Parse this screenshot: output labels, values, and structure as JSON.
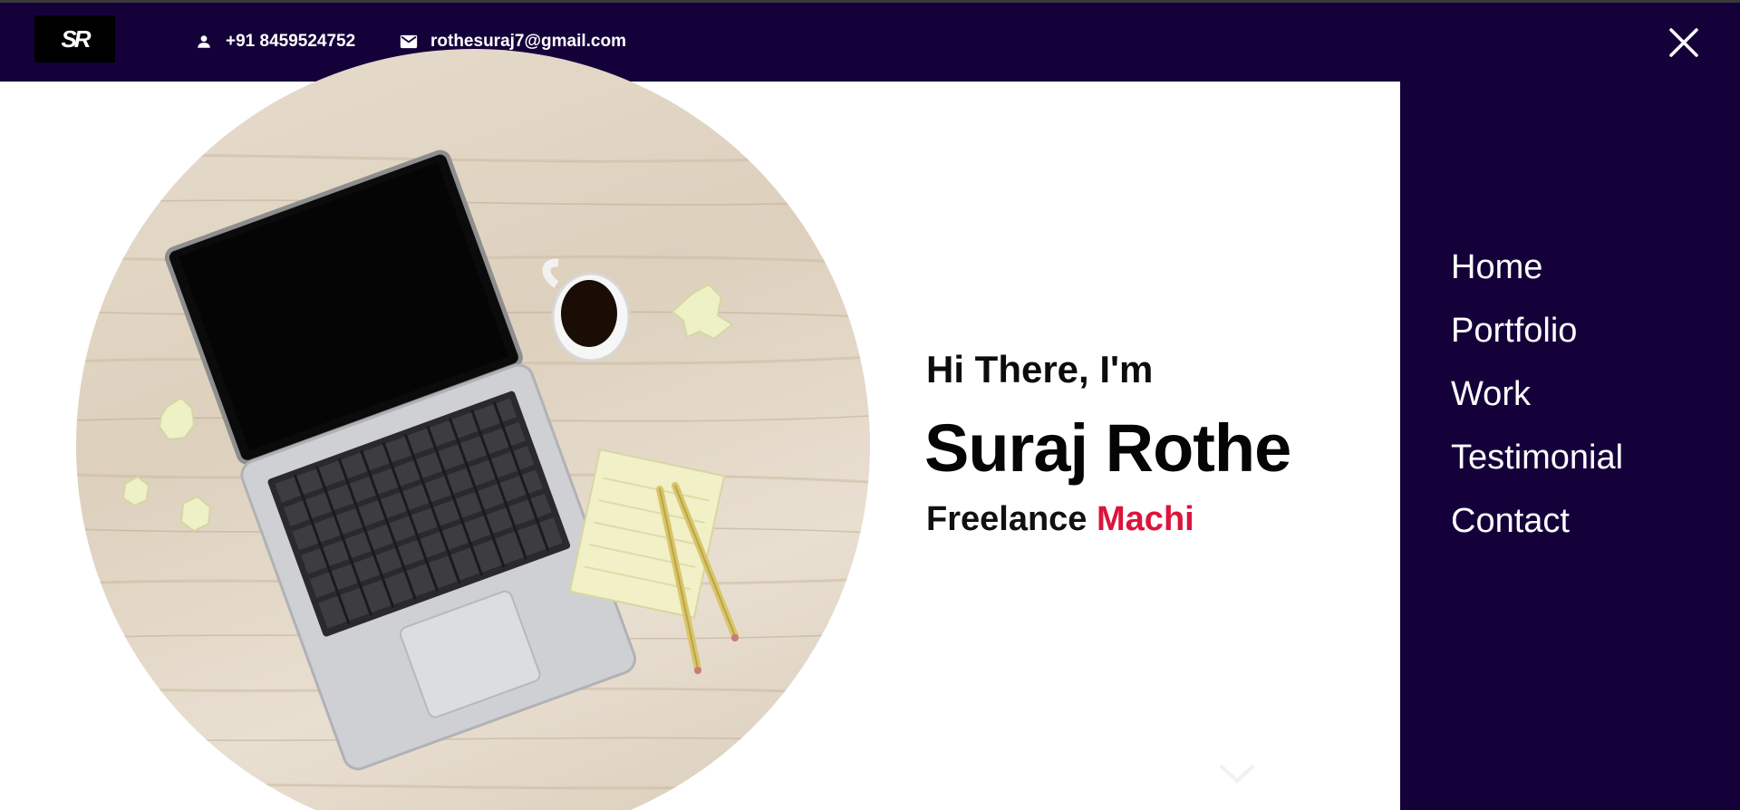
{
  "header": {
    "logo_text": "SR",
    "phone": "+91 8459524752",
    "email": "rothesuraj7@gmail.com",
    "phone_icon": "person-icon",
    "email_icon": "mail-icon",
    "close_icon": "close-icon"
  },
  "hero": {
    "greeting": "Hi There, I'm",
    "name": "Suraj Rothe",
    "role_prefix": "Freelance",
    "role_accent": "Machi",
    "image_alt": "laptop-coffee-desk-photo"
  },
  "menu": {
    "items": [
      {
        "label": "Home"
      },
      {
        "label": "Portfolio"
      },
      {
        "label": "Work"
      },
      {
        "label": "Testimonial"
      },
      {
        "label": "Contact"
      }
    ]
  },
  "colors": {
    "nav_bg": "#15013a",
    "accent": "#dc143c",
    "text_dark": "#050505"
  }
}
